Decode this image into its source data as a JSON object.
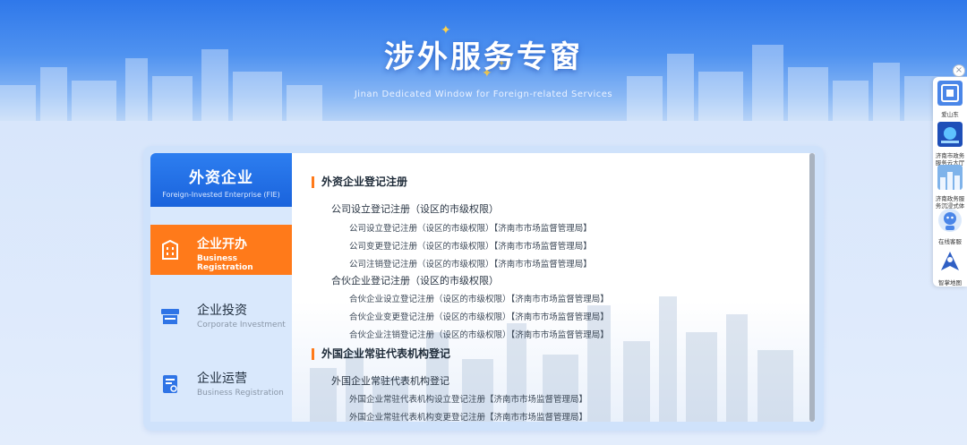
{
  "banner": {
    "title": "涉外服务专窗",
    "subtitle": "Jinan Dedicated Window for Foreign-related Services"
  },
  "sidebar": {
    "header_cn": "外资企业",
    "header_en": "Foreign-Invested Enterprise (FIE)",
    "items": [
      {
        "cn": "企业开办",
        "en": "Business Registration",
        "icon": "building-icon",
        "active": true
      },
      {
        "cn": "企业投资",
        "en": "Corporate Investment",
        "icon": "shop-icon",
        "active": false
      },
      {
        "cn": "企业运营",
        "en": "Business Registration",
        "icon": "document-icon",
        "active": false
      }
    ]
  },
  "content": {
    "sections": [
      {
        "title": "外资企业登记注册",
        "groups": [
          {
            "title": "公司设立登记注册（设区的市级权限）",
            "links": [
              "公司设立登记注册（设区的市级权限）【济南市市场监督管理局】",
              "公司变更登记注册（设区的市级权限）【济南市市场监督管理局】",
              "公司注销登记注册（设区的市级权限）【济南市市场监督管理局】"
            ]
          },
          {
            "title": "合伙企业登记注册（设区的市级权限）",
            "links": [
              "合伙企业设立登记注册（设区的市级权限）【济南市市场监督管理局】",
              "合伙企业变更登记注册（设区的市级权限）【济南市市场监督管理局】",
              "合伙企业注销登记注册（设区的市级权限）【济南市市场监督管理局】"
            ]
          }
        ]
      },
      {
        "title": "外国企业常驻代表机构登记",
        "groups": [
          {
            "title": "外国企业常驻代表机构登记",
            "links": [
              "外国企业常驻代表机构设立登记注册【济南市市场监督管理局】",
              "外国企业常驻代表机构变更登记注册【济南市市场监督管理局】"
            ]
          }
        ]
      }
    ]
  },
  "floatbar": {
    "items": [
      {
        "label": "爱山东"
      },
      {
        "label": "济南市政务服务云大厅"
      },
      {
        "label": "济南政务服务沉浸式体验馆"
      },
      {
        "label": "在线客服"
      },
      {
        "label": "智掌地图"
      }
    ],
    "close": "×"
  },
  "colors": {
    "accent": "#ff7a1a",
    "primary": "#1a63dc",
    "banner": "#3a82ee"
  }
}
